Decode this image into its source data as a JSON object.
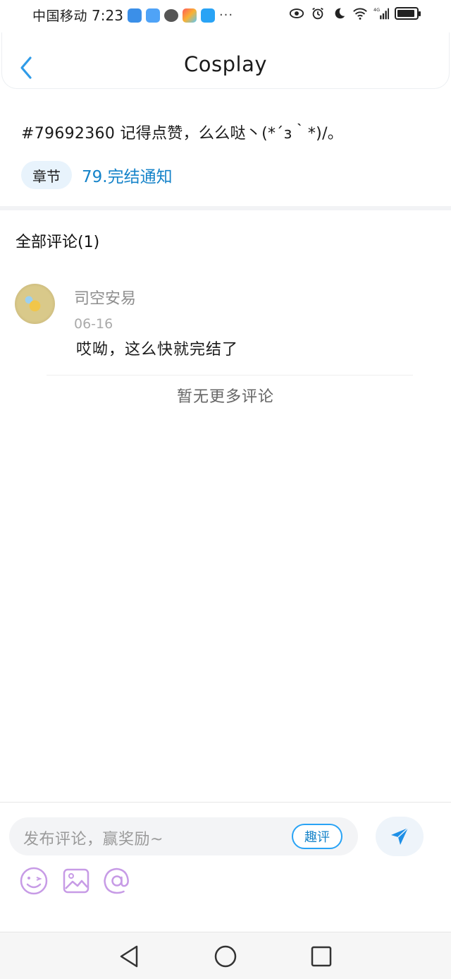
{
  "status_bar": {
    "carrier": "中国移动",
    "time": "7:23",
    "more": "···",
    "network": "4G"
  },
  "header": {
    "title": "Cosplay"
  },
  "post": {
    "text": "#79692360 记得点赞，么么哒丶(*´з｀*)/。",
    "chapter_tag": "章节",
    "chapter_link": "79.完结通知"
  },
  "comments": {
    "title": "全部评论(1)",
    "items": [
      {
        "name": "司空安易",
        "date": "06-16",
        "text": "哎呦，这么快就完结了"
      }
    ],
    "no_more": "暂无更多评论"
  },
  "input_bar": {
    "placeholder": "发布评论，赢奖励~",
    "quping": "趣评",
    "tools": [
      "emoji-icon",
      "image-icon",
      "mention-icon"
    ]
  },
  "colors": {
    "accent": "#1583c9",
    "tool_purple": "#c79be6",
    "send_blue": "#1e8fe6"
  }
}
